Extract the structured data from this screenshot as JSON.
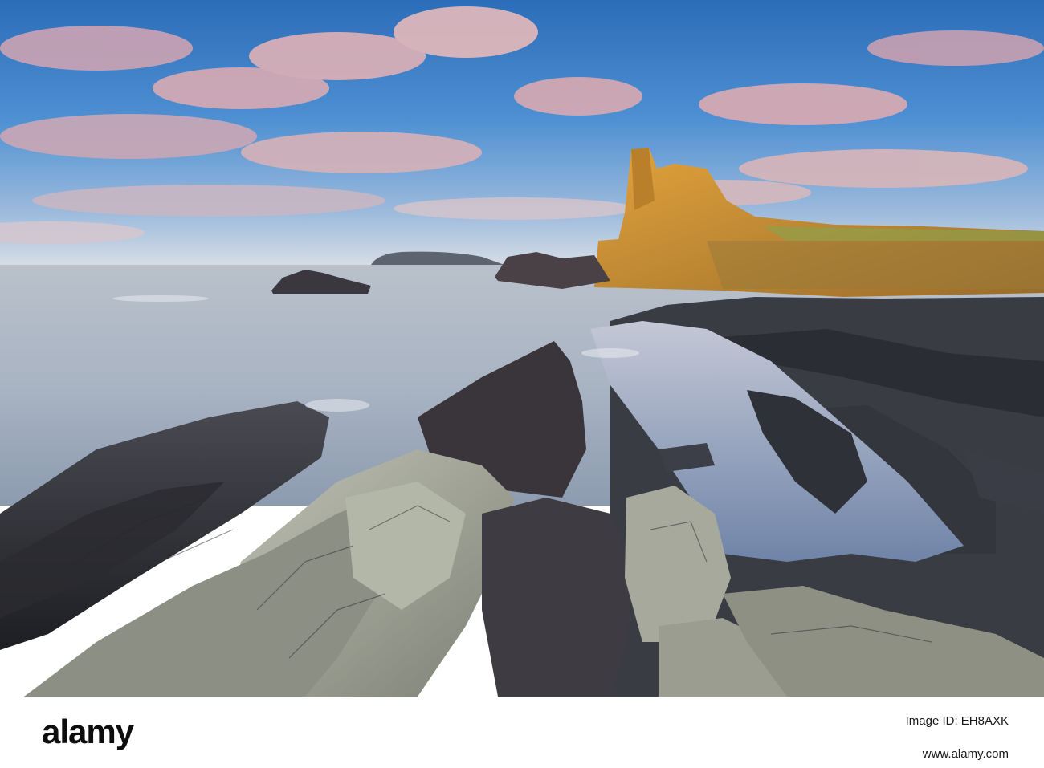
{
  "footer": {
    "logo_text": "alamy",
    "image_id_label": "Image ID: EH8AXK",
    "website": "www.alamy.com"
  },
  "colors": {
    "sky_top": "#2f74c0",
    "sky_mid": "#5b9ad6",
    "cloud_pink": "#d9a9b3",
    "sea": "#aeb8c6",
    "castle_gold": "#c98a2c",
    "rock_dark": "#2b2d33",
    "rock_light": "#a7aa9c"
  }
}
